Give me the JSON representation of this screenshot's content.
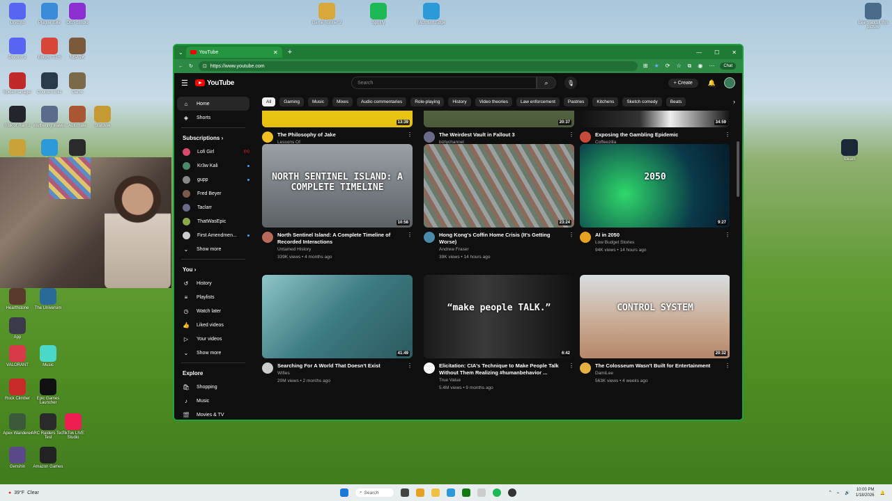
{
  "desktop": {
    "icons_left": [
      {
        "label": "Discord",
        "color": "#5865f2"
      },
      {
        "label": "Plague Elite",
        "color": "#3a8cd8"
      },
      {
        "label": "OBS Studio",
        "color": "#8b2fd1"
      },
      {
        "label": "Discord 2",
        "color": "#5865f2"
      },
      {
        "label": "Bloons TD 6",
        "color": "#d8463a"
      },
      {
        "label": "NBA 2K",
        "color": "#7a5a3a"
      },
      {
        "label": "Spidermanager",
        "color": "#c0282a"
      },
      {
        "label": "Counterstrike",
        "color": "#2a3a4a"
      },
      {
        "label": "Game",
        "color": "#7a6a4a"
      },
      {
        "label": "Risk of Rain 2",
        "color": "#22252b"
      },
      {
        "label": "Wuthering Waves",
        "color": "#5a6a8a"
      },
      {
        "label": "Automate",
        "color": "#aa5533"
      },
      {
        "label": "Stardew",
        "color": "#c69a33"
      },
      {
        "label": "League",
        "color": "#c9a23a"
      },
      {
        "label": "Tool",
        "color": "#2a9ad8"
      },
      {
        "label": "Logitech",
        "color": "#2a2a2a"
      }
    ],
    "icons_left_lower": [
      {
        "label": "Hearthstone",
        "color": "#5a3a2a"
      },
      {
        "label": "The Universim",
        "color": "#2a6a9a"
      },
      {
        "label": "App",
        "color": "#3a3a4a"
      },
      {
        "label": "VALORANT",
        "color": "#d83a4a"
      },
      {
        "label": "Music",
        "color": "#4ad8c8"
      },
      {
        "label": "Rock Climber",
        "color": "#c82a2a"
      },
      {
        "label": "Epic Games Launcher",
        "color": "#111111"
      },
      {
        "label": "Apex Wanderer",
        "color": "#3a5a3a"
      },
      {
        "label": "ARC Raiders Tech Test",
        "color": "#2a2a2a"
      },
      {
        "label": "TikTok LIVE Studio",
        "color": "#ee1d52"
      },
      {
        "label": "Genshin",
        "color": "#5a4a8a"
      },
      {
        "label": "Amazon Games",
        "color": "#222222"
      }
    ],
    "icons_top": [
      {
        "label": "Game Runner 2",
        "color": "#d8a83a"
      },
      {
        "label": "Spotify",
        "color": "#1db954"
      },
      {
        "label": "Microsoft Edge",
        "color": "#2a9ad8"
      }
    ],
    "icons_right": [
      {
        "label": "Learn about this picture"
      },
      {
        "label": "Steam",
        "color": "#1b2838"
      }
    ]
  },
  "browser": {
    "tab_title": "YouTube",
    "url": "https://www.youtube.com",
    "chat_label": "Chat"
  },
  "youtube": {
    "search_placeholder": "Search",
    "create_label": "Create",
    "sidebar": {
      "main": [
        {
          "label": "Home",
          "icon": "⌂"
        },
        {
          "label": "Shorts",
          "icon": "◈"
        }
      ],
      "subs_header": "Subscriptions ›",
      "subs": [
        {
          "label": "Lofi Girl",
          "color": "#d84a6a",
          "badge": "live"
        },
        {
          "label": "Kr3w Kali",
          "color": "#4a8a6a",
          "badge": "dot"
        },
        {
          "label": "gupp",
          "color": "#888888",
          "badge": "dot"
        },
        {
          "label": "Fred Beyer",
          "color": "#7a5a4a",
          "badge": ""
        },
        {
          "label": "Taclarr",
          "color": "#6a6a8a",
          "badge": ""
        },
        {
          "label": "ThatWasEpic",
          "color": "#8aa84a",
          "badge": ""
        },
        {
          "label": "First Amendmen...",
          "color": "#cccccc",
          "badge": "dot"
        },
        {
          "label": "Show more",
          "color": "",
          "badge": ""
        }
      ],
      "you_header": "You ›",
      "you": [
        {
          "label": "History",
          "icon": "↺"
        },
        {
          "label": "Playlists",
          "icon": "≡"
        },
        {
          "label": "Watch later",
          "icon": "◷"
        },
        {
          "label": "Liked videos",
          "icon": "👍"
        },
        {
          "label": "Your videos",
          "icon": "▷"
        },
        {
          "label": "Show more",
          "icon": "⌄"
        }
      ],
      "explore_header": "Explore",
      "explore": [
        {
          "label": "Shopping",
          "icon": "🛍"
        },
        {
          "label": "Music",
          "icon": "♪"
        },
        {
          "label": "Movies & TV",
          "icon": "🎬"
        }
      ]
    },
    "chips": [
      "All",
      "Gaming",
      "Music",
      "Mixes",
      "Audio commentaries",
      "Role-playing",
      "History",
      "Video theories",
      "Law enforcement",
      "Pastries",
      "Kitchens",
      "Sketch comedy",
      "Beats"
    ],
    "videos": [
      {
        "title": "The Philosophy of Jake",
        "channel": "Lessons Of",
        "stats": "609K views • 4 months ago",
        "duration": "13:39",
        "thumb": "linear-gradient(180deg,#f2d51e,#e6c110)",
        "avatar": "#f0c020"
      },
      {
        "title": "The Weirdest Vault in Fallout 3",
        "channel": "bizlychannel",
        "stats": "826K views • 2 months ago",
        "duration": "20:37",
        "thumb": "linear-gradient(180deg,#7a8a5a,#4a5a3a)",
        "avatar": "#6a6a8a"
      },
      {
        "title": "Exposing the Gambling Epidemic",
        "channel": "Coffeezilla",
        "stats": "7.1M views • 2 months ago",
        "duration": "34:59",
        "thumb": "linear-gradient(90deg,#111,#333 40%,#eee 60%,#111)",
        "avatar": "#c84a3a"
      },
      {
        "title": "North Sentinel Island: A Complete Timeline of Recorded Interactions",
        "channel": "Untamed History",
        "stats": "339K views • 4 months ago",
        "duration": "10:58",
        "thumb": "linear-gradient(180deg,#9aa0a6,#5c6166)",
        "avatar": "#b86a5a",
        "text": "NORTH SENTINEL ISLAND: A COMPLETE TIMELINE"
      },
      {
        "title": "Hong Kong's Coffin Home Crisis (It's Getting Worse)",
        "channel": "Andrew Fraser",
        "stats": "39K views • 14 hours ago",
        "duration": "23:24",
        "thumb": "repeating-linear-gradient(60deg,#6a7a6a 0 6px,#8a6a5a 6px 12px,#9aa0a0 12px 18px)",
        "avatar": "#4a8aaa"
      },
      {
        "title": "AI in 2050",
        "channel": "Low Budget Stories",
        "stats": "94K views • 14 hours ago",
        "duration": "9:27",
        "thumb": "radial-gradient(circle at 30% 60%,#2fd86a,#0a3a4a 60%,#061a2a)",
        "avatar": "#e8a020",
        "text": "2050"
      },
      {
        "title": "Searching For A World That Doesn't Exist",
        "channel": "Wifies",
        "stats": "20M views • 2 months ago",
        "duration": "41:49",
        "thumb": "linear-gradient(135deg,#8ec5c9,#3d7a82 50%,#2c5a60)",
        "avatar": "#cccccc"
      },
      {
        "title": "Elicitation: CIA's Technique to Make People Talk Without Them Realizing #humanbehavior ...",
        "channel": "True Value",
        "stats": "5.4M views • 9 months ago",
        "duration": "6:42",
        "thumb": "linear-gradient(90deg,#1a1a1a,#3a3a3a 40%,#111)",
        "avatar": "#ffffff",
        "text": "“make people TALK.”"
      },
      {
        "title": "The Colosseum Wasn't Built for Entertainment",
        "channel": "DamiLee",
        "stats": "563K views • 4 weeks ago",
        "duration": "20:32",
        "thumb": "linear-gradient(180deg,#d8dde0,#c9a890 60%,#b5866a)",
        "avatar": "#e8b040",
        "text": "CONTROL SYSTEM"
      }
    ]
  },
  "taskbar": {
    "weather_temp": "39°F",
    "weather_desc": "Clear",
    "search_label": "Search",
    "time": "10:00 PM",
    "date": "1/18/2026"
  }
}
